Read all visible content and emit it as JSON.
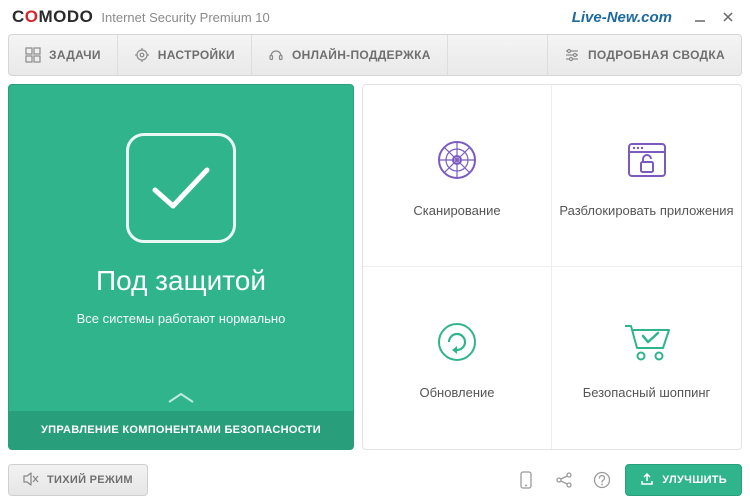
{
  "title": {
    "logo_plain": "C",
    "logo_red": "O",
    "logo_rest": "MODO",
    "product": "Internet Security Premium 10",
    "brand_link": "Live-New.com"
  },
  "toolbar": {
    "tasks": "ЗАДАЧИ",
    "settings": "НАСТРОЙКИ",
    "support": "ОНЛАЙН-ПОДДЕРЖКА",
    "detailed": "ПОДРОБНАЯ СВОДКА"
  },
  "status": {
    "title": "Под защитой",
    "subtitle": "Все системы работают нормально",
    "footer": "УПРАВЛЕНИЕ КОМПОНЕНТАМИ БЕЗОПАСНОСТИ"
  },
  "tiles": {
    "scan": "Сканирование",
    "unblock": "Разблокировать приложения",
    "update": "Обновление",
    "shopping": "Безопасный шоппинг"
  },
  "bottom": {
    "quiet": "ТИХИЙ РЕЖИМ",
    "upgrade": "УЛУЧШИТЬ"
  },
  "colors": {
    "accent_green": "#2fb48c",
    "purple_icon": "#7c5bbf"
  }
}
